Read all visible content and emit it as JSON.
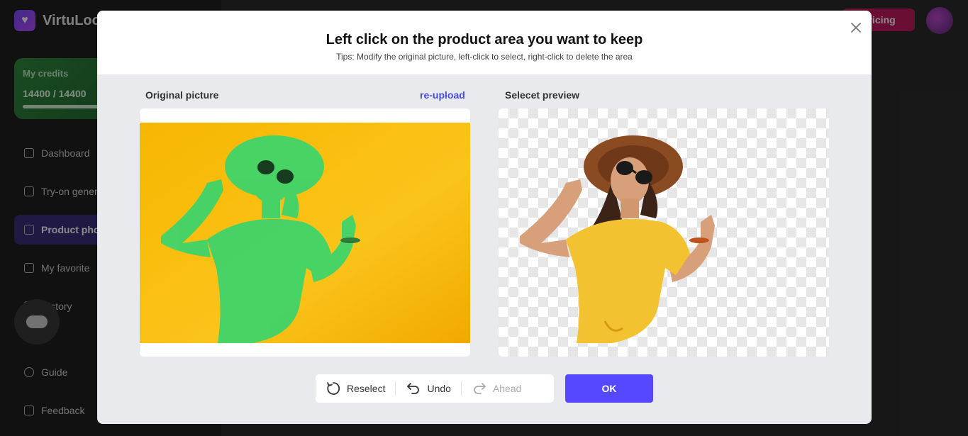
{
  "app": {
    "name": "VirtuLoo",
    "pricing_label": "Pricing",
    "credits": {
      "label": "My credits",
      "value": "14400 / 14400"
    },
    "nav": [
      {
        "label": "Dashboard"
      },
      {
        "label": "Try-on generation"
      },
      {
        "label": "Product photo"
      },
      {
        "label": "My favorite"
      },
      {
        "label": "History"
      },
      {
        "label": "Guide"
      },
      {
        "label": "Feedback"
      }
    ]
  },
  "modal": {
    "title": "Left click on the product area you want to keep",
    "tips": "Tips: Modify the original picture, left-click to select, right-click to delete the area",
    "original_label": "Original picture",
    "reupload_label": "re-upload",
    "preview_label": "Selecet preview",
    "toolbar": {
      "reselect_label": "Reselect",
      "undo_label": "Undo",
      "ahead_label": "Ahead"
    },
    "ok_label": "OK"
  },
  "colors": {
    "accent": "#5548ff",
    "link": "#4a4bd8",
    "selection_green": "#3fd46a",
    "photo_yellow": "#f7b900",
    "shirt_yellow": "#f2c230",
    "hat_brown": "#8a4a22"
  },
  "icons": {
    "close": "close-icon",
    "reselect": "reselect-icon",
    "undo": "undo-icon",
    "ahead": "redo-icon"
  }
}
